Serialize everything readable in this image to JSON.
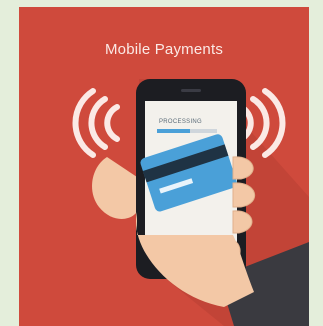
{
  "illustration": {
    "title": "Mobile Payments",
    "screen_text": "PROCESSING",
    "progress": 0.55,
    "colors": {
      "background": "#cf4a3c",
      "phone": "#1c1d22",
      "screen": "#f3f1ec",
      "card": "#4aa0d8",
      "skin": "#f3c8a6",
      "sleeve": "#3a3a40"
    },
    "icons": [
      "left-nfc-waves-icon",
      "right-nfc-waves-icon",
      "credit-card-icon"
    ]
  }
}
